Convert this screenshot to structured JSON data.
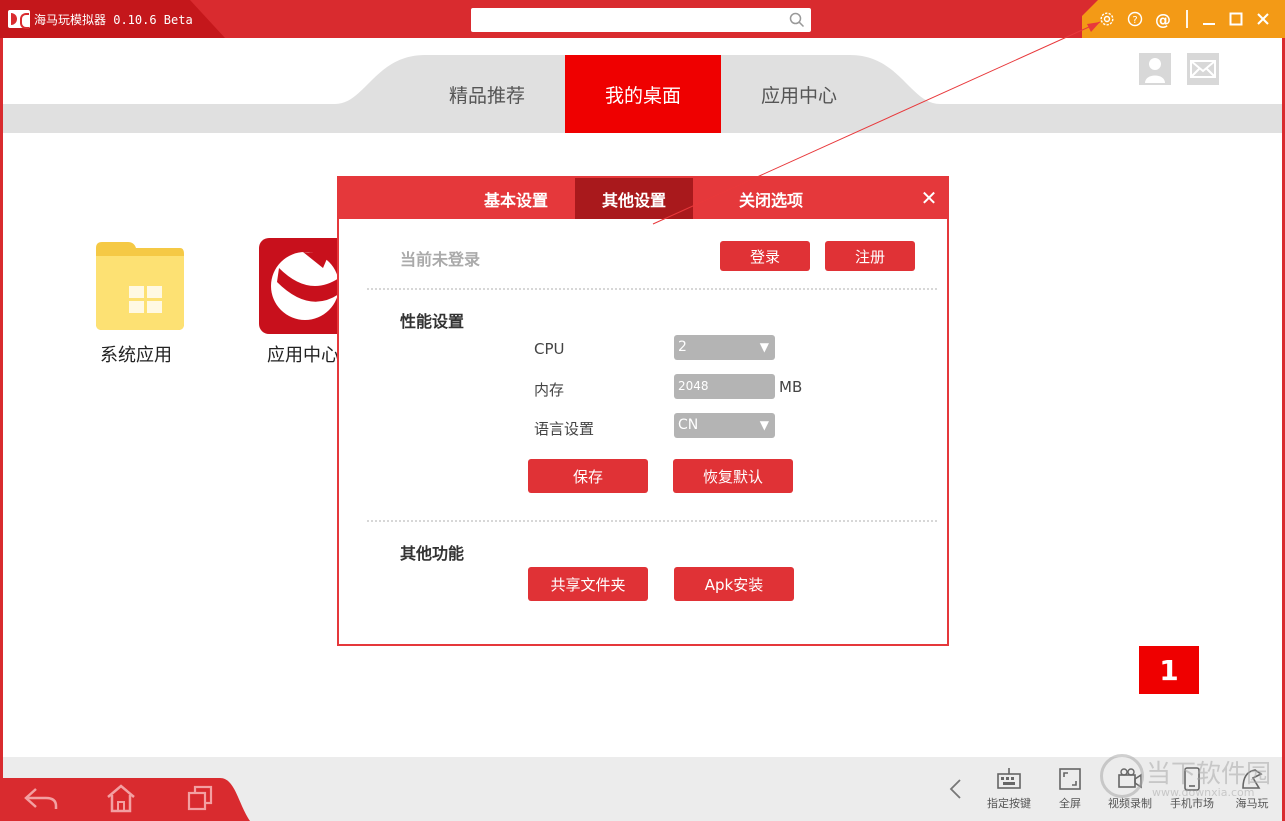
{
  "app": {
    "title": "海马玩模拟器 0.10.6 Beta"
  },
  "search": {
    "placeholder": "",
    "value": ""
  },
  "titlebar_icons": [
    "gear-icon",
    "help-icon",
    "at-icon",
    "minimize-icon",
    "maximize-icon",
    "close-icon"
  ],
  "nav": {
    "tabs": [
      "精品推荐",
      "我的桌面",
      "应用中心"
    ],
    "active": "我的桌面"
  },
  "desktop": {
    "items": [
      {
        "label": "系统应用",
        "icon": "folder-icon"
      },
      {
        "label": "应用中心",
        "icon": "app-center-icon"
      }
    ]
  },
  "dialog": {
    "tabs": [
      "基本设置",
      "其他设置",
      "关闭选项"
    ],
    "active_tab": "其他设置",
    "login_status": "当前未登录",
    "login_button": "登录",
    "register_button": "注册",
    "performance": {
      "heading": "性能设置",
      "cpu_label": "CPU",
      "cpu_value": "2",
      "memory_label": "内存",
      "memory_value": "2048",
      "memory_unit": "MB",
      "language_label": "语言设置",
      "language_value": "CN",
      "save_button": "保存",
      "reset_button": "恢复默认"
    },
    "other": {
      "heading": "其他功能",
      "shared_folder_button": "共享文件夹",
      "apk_install_button": "Apk安装"
    }
  },
  "annotation_number": "1",
  "bottom": {
    "left_icons": [
      "back-icon",
      "home-icon",
      "recent-apps-icon"
    ],
    "right_items": [
      "指定按键",
      "全屏",
      "视频录制",
      "手机市场",
      "海马玩"
    ]
  },
  "watermark": {
    "text": "当下软件园",
    "sub": "www.downxia.com"
  },
  "colors": {
    "accent": "#d92b2f",
    "active_tab": "#ef0000",
    "orange": "#f39a16",
    "dialog_tab_active": "#a9191c"
  }
}
